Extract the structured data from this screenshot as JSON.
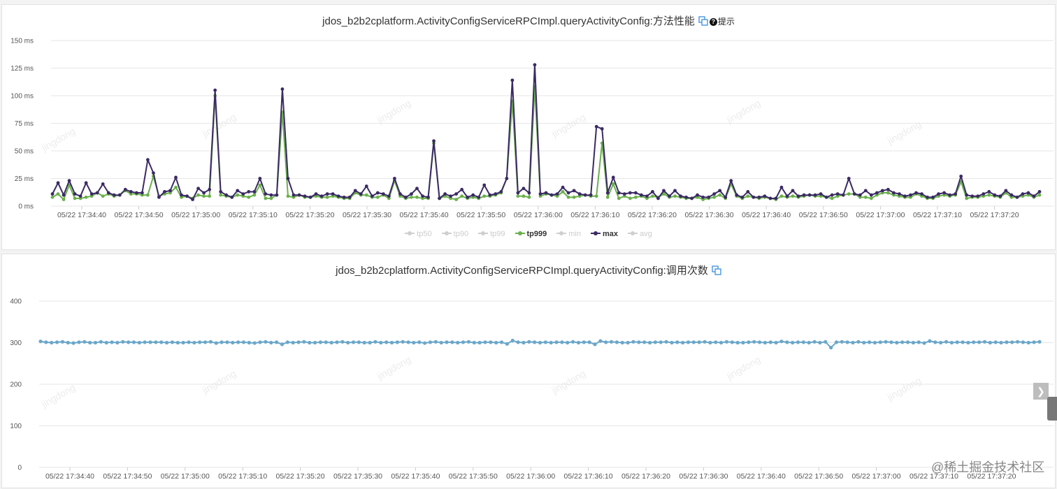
{
  "top_chart": {
    "title": "jdos_b2b2cplatform.ActivityConfigServiceRPCImpl.queryActivityConfig:方法性能",
    "tip_label": "提示",
    "copy_icon": "copy-icon",
    "tip_icon": "question-circle-icon",
    "chart_data": {
      "type": "line",
      "y_tick_labels": [
        "150 ms",
        "125 ms",
        "100 ms",
        "75 ms",
        "50 ms",
        "25 ms",
        "0 ms"
      ],
      "ylim": [
        0,
        150
      ],
      "categories": [
        "05/22 17:34:40",
        "05/22 17:34:50",
        "05/22 17:35:00",
        "05/22 17:35:10",
        "05/22 17:35:20",
        "05/22 17:35:30",
        "05/22 17:35:40",
        "05/22 17:35:50",
        "05/22 17:36:00",
        "05/22 17:36:10",
        "05/22 17:36:20",
        "05/22 17:36:30",
        "05/22 17:36:40",
        "05/22 17:36:50",
        "05/22 17:37:00",
        "05/22 17:37:10",
        "05/22 17:37:20"
      ],
      "x_start": "05/22 17:34:35",
      "x_step_seconds": 0.61,
      "legend": [
        {
          "name": "tp50",
          "active": false
        },
        {
          "name": "tp90",
          "active": false
        },
        {
          "name": "tp99",
          "active": false
        },
        {
          "name": "tp999",
          "active": true
        },
        {
          "name": "min",
          "active": false
        },
        {
          "name": "max",
          "active": true
        },
        {
          "name": "avg",
          "active": false
        }
      ],
      "series": [
        {
          "name": "max",
          "color": "#3b2a64",
          "values": [
            11,
            21,
            10,
            23,
            11,
            9,
            21,
            11,
            12,
            20,
            12,
            10,
            10,
            15,
            13,
            12,
            12,
            42,
            30,
            8,
            13,
            14,
            26,
            10,
            9,
            6,
            16,
            12,
            15,
            105,
            13,
            10,
            8,
            14,
            11,
            13,
            13,
            25,
            11,
            10,
            10,
            106,
            25,
            10,
            10,
            9,
            8,
            11,
            9,
            11,
            11,
            9,
            8,
            8,
            14,
            11,
            18,
            9,
            12,
            11,
            9,
            25,
            11,
            8,
            11,
            16,
            9,
            8,
            59,
            7,
            11,
            9,
            11,
            15,
            8,
            10,
            8,
            19,
            10,
            11,
            13,
            25,
            114,
            12,
            16,
            12,
            128,
            11,
            12,
            10,
            11,
            17,
            12,
            14,
            11,
            10,
            10,
            72,
            70,
            12,
            26,
            12,
            11,
            12,
            12,
            10,
            9,
            13,
            7,
            14,
            9,
            14,
            9,
            8,
            7,
            10,
            8,
            8,
            11,
            14,
            8,
            23,
            10,
            8,
            13,
            8,
            8,
            9,
            7,
            7,
            17,
            9,
            14,
            9,
            10,
            10,
            10,
            11,
            8,
            10,
            11,
            10,
            25,
            11,
            10,
            14,
            10,
            12,
            14,
            15,
            12,
            11,
            9,
            10,
            12,
            11,
            8,
            8,
            11,
            12,
            10,
            11,
            27,
            10,
            9,
            9,
            11,
            13,
            10,
            9,
            14,
            10,
            8,
            11,
            12,
            9,
            13
          ]
        },
        {
          "name": "tp999",
          "color": "#6ab04c",
          "values": [
            8,
            11,
            6,
            19,
            7,
            7,
            8,
            9,
            12,
            9,
            11,
            9,
            10,
            14,
            11,
            11,
            10,
            10,
            27,
            9,
            11,
            12,
            17,
            8,
            9,
            7,
            10,
            9,
            9,
            100,
            10,
            9,
            8,
            10,
            9,
            8,
            10,
            19,
            7,
            7,
            10,
            85,
            9,
            8,
            10,
            8,
            8,
            9,
            8,
            8,
            9,
            8,
            7,
            7,
            12,
            10,
            10,
            8,
            8,
            10,
            7,
            23,
            9,
            7,
            8,
            8,
            7,
            7,
            57,
            7,
            9,
            7,
            6,
            9,
            7,
            8,
            7,
            9,
            9,
            10,
            12,
            25,
            95,
            9,
            9,
            8,
            108,
            9,
            11,
            10,
            9,
            13,
            8,
            8,
            9,
            10,
            9,
            9,
            57,
            8,
            20,
            7,
            9,
            7,
            8,
            9,
            7,
            9,
            8,
            11,
            8,
            9,
            8,
            7,
            7,
            8,
            6,
            7,
            8,
            10,
            7,
            20,
            9,
            7,
            9,
            8,
            7,
            8,
            7,
            6,
            9,
            8,
            9,
            8,
            9,
            10,
            9,
            9,
            8,
            7,
            9,
            10,
            11,
            11,
            8,
            8,
            7,
            10,
            12,
            12,
            10,
            9,
            8,
            8,
            11,
            9,
            7,
            7,
            9,
            10,
            9,
            10,
            22,
            7,
            8,
            8,
            9,
            10,
            9,
            8,
            12,
            8,
            8,
            9,
            10,
            8,
            10
          ]
        }
      ]
    }
  },
  "bottom_chart": {
    "title": "jdos_b2b2cplatform.ActivityConfigServiceRPCImpl.queryActivityConfig:调用次数",
    "copy_icon": "copy-icon",
    "chart_data": {
      "type": "line",
      "y_tick_labels": [
        "400",
        "300",
        "200",
        "100",
        "0"
      ],
      "ylim": [
        0,
        400
      ],
      "categories": [
        "05/22 17:34:40",
        "05/22 17:34:50",
        "05/22 17:35:00",
        "05/22 17:35:10",
        "05/22 17:35:20",
        "05/22 17:35:30",
        "05/22 17:35:40",
        "05/22 17:35:50",
        "05/22 17:36:00",
        "05/22 17:36:10",
        "05/22 17:36:20",
        "05/22 17:36:30",
        "05/22 17:36:40",
        "05/22 17:36:50",
        "05/22 17:37:00",
        "05/22 17:37:10",
        "05/22 17:37:20"
      ],
      "series": [
        {
          "name": "调用次数",
          "color": "#6aa7c9",
          "values": [
            303,
            301,
            300,
            301,
            302,
            300,
            299,
            301,
            302,
            300,
            300,
            302,
            300,
            301,
            300,
            302,
            301,
            301,
            300,
            301,
            301,
            301,
            301,
            300,
            301,
            300,
            300,
            301,
            300,
            301,
            301,
            302,
            299,
            301,
            301,
            300,
            301,
            301,
            300,
            299,
            301,
            302,
            300,
            301,
            296,
            301,
            300,
            301,
            302,
            300,
            300,
            301,
            301,
            300,
            301,
            302,
            300,
            301,
            301,
            300,
            300,
            302,
            300,
            301,
            300,
            301,
            302,
            301,
            300,
            301,
            299,
            301,
            302,
            300,
            301,
            301,
            300,
            301,
            302,
            300,
            300,
            301,
            301,
            300,
            301,
            297,
            305,
            301,
            300,
            302,
            301,
            300,
            301,
            300,
            301,
            301,
            300,
            302,
            300,
            301,
            301,
            296,
            304,
            301,
            302,
            301,
            300,
            300,
            302,
            301,
            301,
            300,
            301,
            301,
            302,
            300,
            301,
            300,
            301,
            301,
            301,
            302,
            300,
            301,
            300,
            302,
            301,
            300,
            300,
            301,
            302,
            301,
            300,
            301,
            300,
            303,
            301,
            300,
            301,
            301,
            300,
            302,
            300,
            302,
            288,
            301,
            302,
            301,
            300,
            302,
            300,
            301,
            300,
            301,
            302,
            301,
            300,
            301,
            301,
            300,
            301,
            299,
            304,
            301,
            300,
            302,
            300,
            301,
            301,
            300,
            301,
            301,
            302,
            300,
            301,
            300,
            301,
            301,
            302,
            301,
            300,
            301,
            302
          ]
        }
      ]
    }
  },
  "side_button_icon": "chevron-right-icon",
  "watermark": "jingdong",
  "source_mark": "@稀土掘金技术社区"
}
